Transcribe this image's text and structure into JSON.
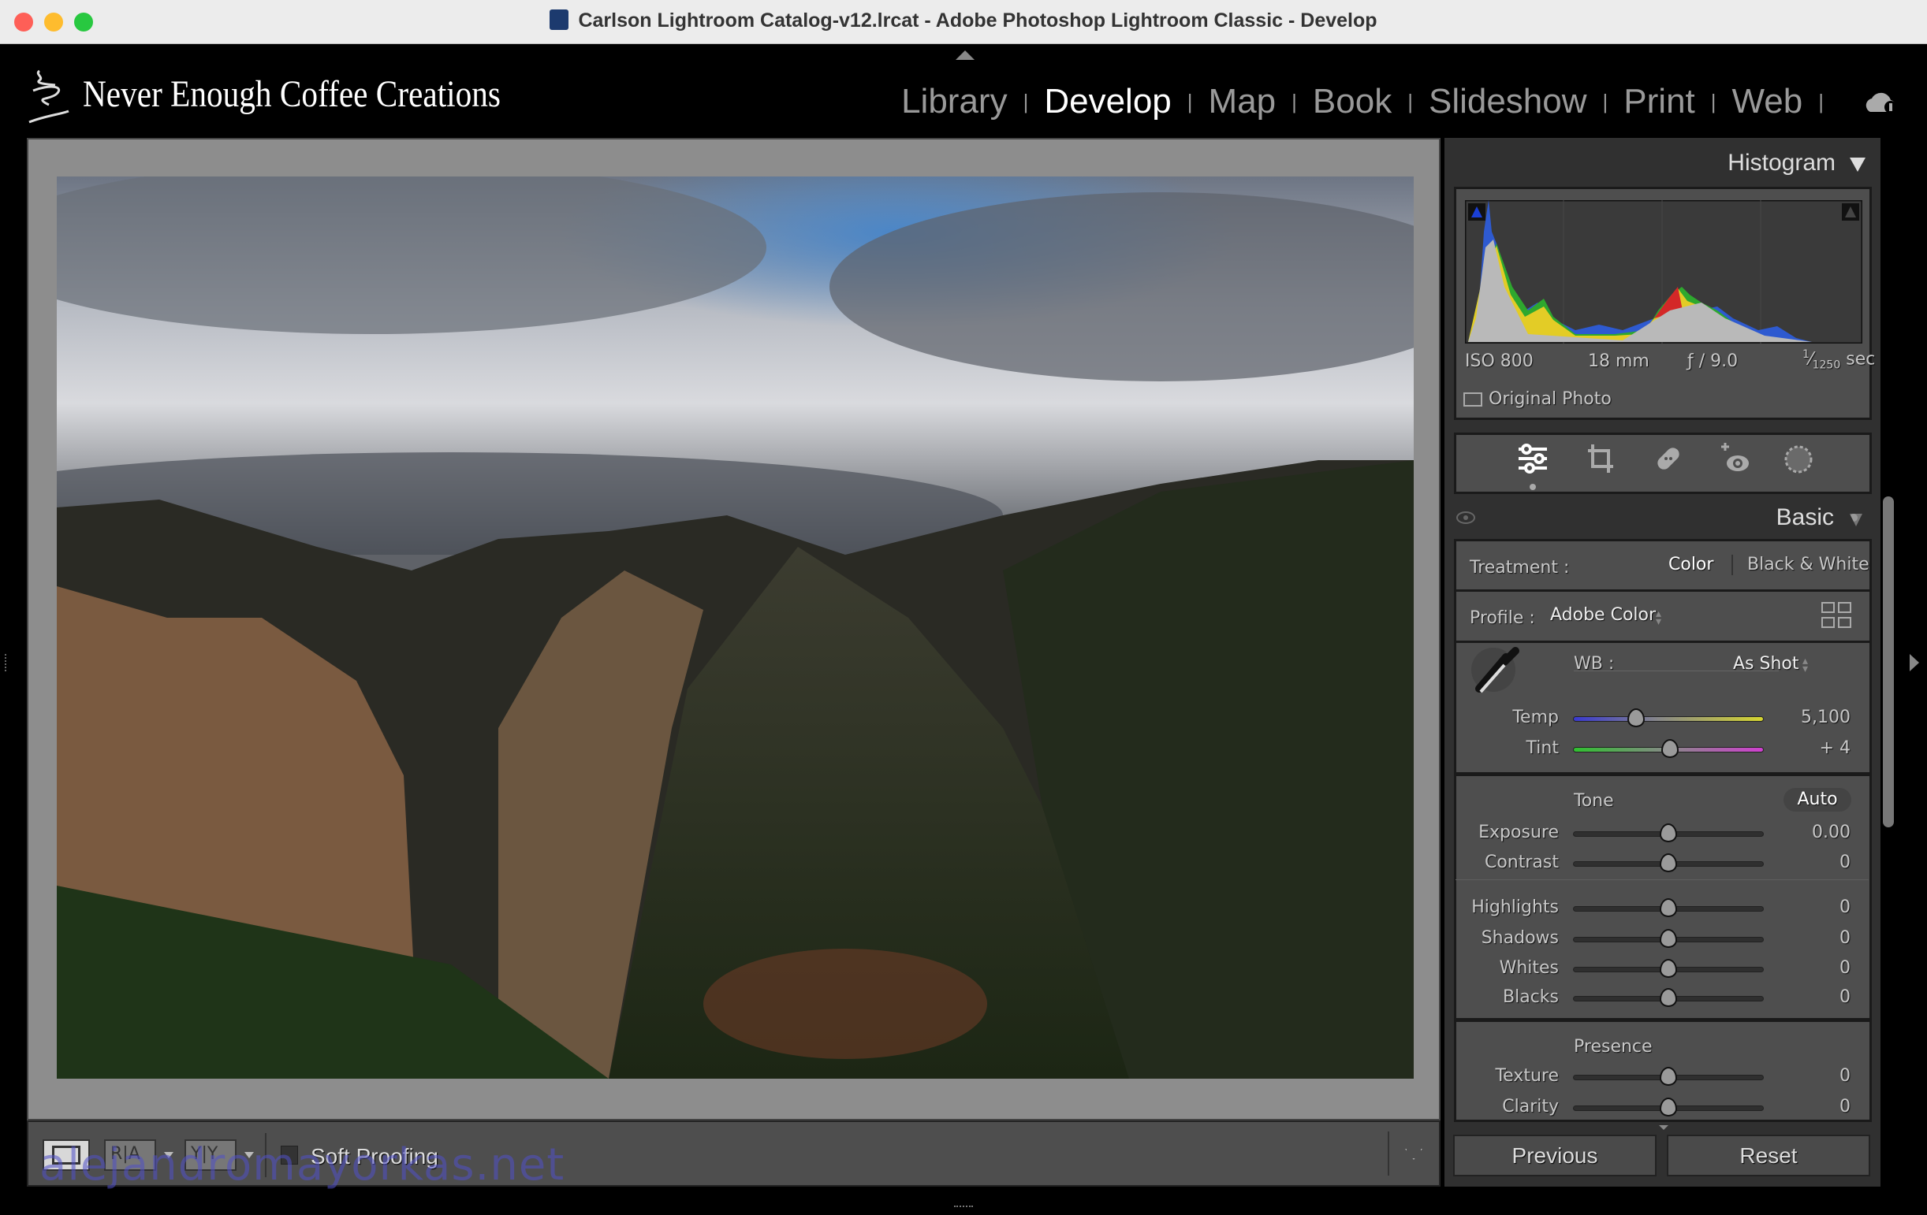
{
  "window": {
    "title": "Carlson Lightroom Catalog-v12.lrcat - Adobe Photoshop Lightroom Classic - Develop"
  },
  "identity_plate": "Never Enough Coffee Creations",
  "modules": [
    {
      "label": "Library"
    },
    {
      "label": "Develop",
      "active": true
    },
    {
      "label": "Map"
    },
    {
      "label": "Book"
    },
    {
      "label": "Slideshow"
    },
    {
      "label": "Print"
    },
    {
      "label": "Web"
    }
  ],
  "histogram": {
    "title": "Histogram",
    "iso": "ISO 800",
    "focal": "18 mm",
    "aperture": "ƒ / 9.0",
    "shutter_num": "1",
    "shutter_den": "1250",
    "shutter_unit": "sec",
    "original_photo": "Original Photo",
    "clip_shadow_color": "#1a3fd6"
  },
  "tools": [
    "edit-sliders",
    "crop",
    "healing",
    "red-eye",
    "masking"
  ],
  "basic": {
    "title": "Basic",
    "treatment_label": "Treatment :",
    "treatment_color": "Color",
    "treatment_bw": "Black & White",
    "profile_label": "Profile :",
    "profile_value": "Adobe Color",
    "wb_label": "WB :",
    "wb_value": "As Shot",
    "tone_label": "Tone",
    "auto_label": "Auto",
    "presence_label": "Presence",
    "sliders": [
      {
        "label": "Temp",
        "value": "5,100",
        "position": 0.33,
        "track": "temp"
      },
      {
        "label": "Tint",
        "value": "+ 4",
        "position": 0.51,
        "track": "tint"
      },
      {
        "label": "Exposure",
        "value": "0.00",
        "position": 0.5
      },
      {
        "label": "Contrast",
        "value": "0",
        "position": 0.5
      },
      {
        "label": "Highlights",
        "value": "0",
        "position": 0.5
      },
      {
        "label": "Shadows",
        "value": "0",
        "position": 0.5
      },
      {
        "label": "Whites",
        "value": "0",
        "position": 0.5
      },
      {
        "label": "Blacks",
        "value": "0",
        "position": 0.5
      },
      {
        "label": "Texture",
        "value": "0",
        "position": 0.5
      },
      {
        "label": "Clarity",
        "value": "0",
        "position": 0.5
      }
    ]
  },
  "buttons": {
    "previous": "Previous",
    "reset": "Reset"
  },
  "toolbar": {
    "soft_proofing": "Soft Proofing",
    "view_ra": "R|A",
    "view_yy": "Y|Y"
  },
  "watermark": "alejandromayorkas.net"
}
